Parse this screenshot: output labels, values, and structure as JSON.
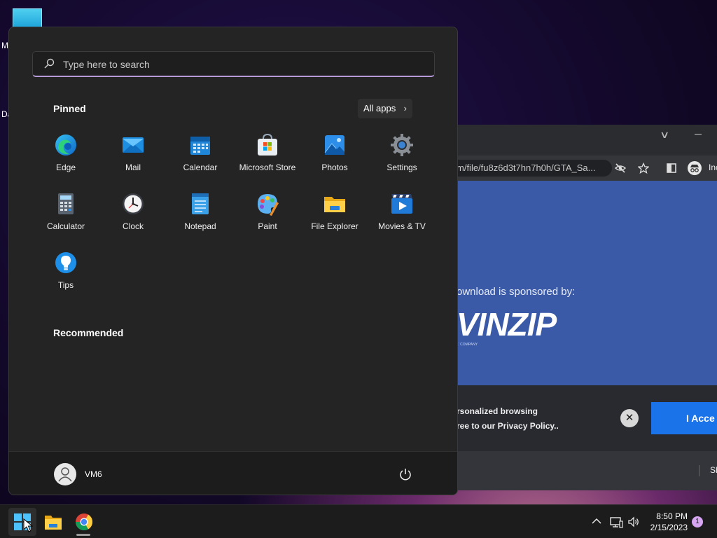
{
  "desktop": {
    "icon_labels": [
      "M",
      "Da"
    ]
  },
  "browser": {
    "url": "m/file/fu8z6d3t7hn7h0h/GTA_Sa...",
    "incognito_label": "Inc",
    "sponsor_text": "ownload is sponsored by:",
    "brand": "VINZIP",
    "brand_sub": "L' COMPANY",
    "cookie_line1": "rsonalized browsing",
    "cookie_line2": "ree to our Privacy Policy..",
    "close_symbol": "✕",
    "accept_label": "I Acce",
    "bottom_text": "Sh",
    "icons": [
      "chevron-down-icon",
      "minimize-icon",
      "eye-slash-icon",
      "star-icon",
      "sidebar-icon",
      "incognito-icon"
    ]
  },
  "start_menu": {
    "search_placeholder": "Type here to search",
    "pinned_heading": "Pinned",
    "all_apps_label": "All apps",
    "all_apps_chevron": "›",
    "pinned_apps": [
      {
        "label": "Edge",
        "icon": "edge-icon"
      },
      {
        "label": "Mail",
        "icon": "mail-icon"
      },
      {
        "label": "Calendar",
        "icon": "calendar-icon"
      },
      {
        "label": "Microsoft Store",
        "icon": "store-icon"
      },
      {
        "label": "Photos",
        "icon": "photos-icon"
      },
      {
        "label": "Settings",
        "icon": "settings-icon"
      },
      {
        "label": "Calculator",
        "icon": "calculator-icon"
      },
      {
        "label": "Clock",
        "icon": "clock-icon"
      },
      {
        "label": "Notepad",
        "icon": "notepad-icon"
      },
      {
        "label": "Paint",
        "icon": "paint-icon"
      },
      {
        "label": "File Explorer",
        "icon": "folder-icon"
      },
      {
        "label": "Movies & TV",
        "icon": "movies-icon"
      },
      {
        "label": "Tips",
        "icon": "tips-icon"
      }
    ],
    "recommended_heading": "Recommended",
    "user_name": "VM6"
  },
  "taskbar": {
    "apps": [
      "windows-logo-icon",
      "file-explorer-icon",
      "chrome-icon"
    ],
    "time": "8:50 PM",
    "date": "2/15/2023",
    "notification_count": "1"
  },
  "colors": {
    "start_bg": "#242424",
    "search_accent": "#b79bd8",
    "taskbar_bg": "#1c1c1c",
    "accept_button": "#1a73e8",
    "page_blue": "#3a5aa8",
    "notification_badge": "#d7a6f2"
  }
}
